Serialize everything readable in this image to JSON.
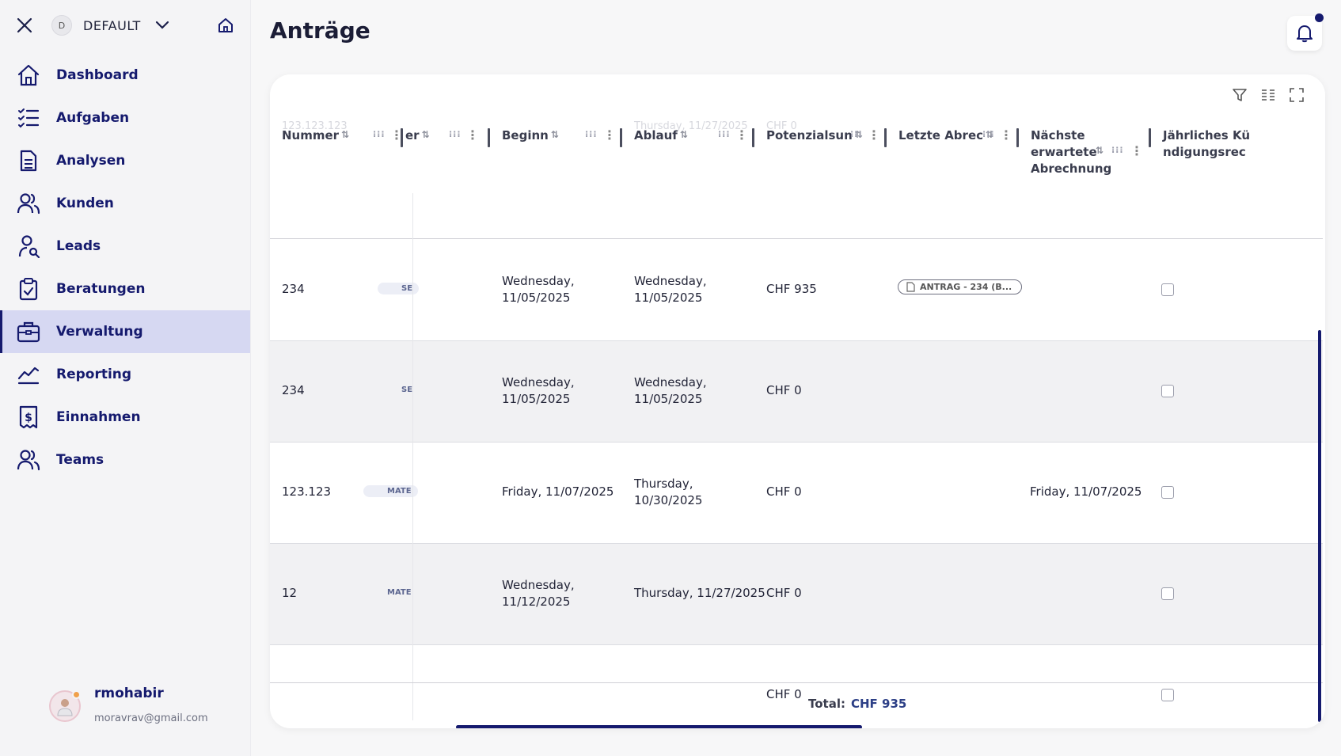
{
  "sidebar": {
    "org_badge": "D",
    "org_name": "DEFAULT",
    "nav": [
      {
        "label": "Dashboard",
        "icon": "home-icon"
      },
      {
        "label": "Aufgaben",
        "icon": "task-list-icon"
      },
      {
        "label": "Analysen",
        "icon": "document-icon"
      },
      {
        "label": "Kunden",
        "icon": "customers-icon"
      },
      {
        "label": "Leads",
        "icon": "leads-icon"
      },
      {
        "label": "Beratungen",
        "icon": "clipboard-icon"
      },
      {
        "label": "Verwaltung",
        "icon": "briefcase-icon",
        "active": true
      },
      {
        "label": "Reporting",
        "icon": "chart-line-icon"
      },
      {
        "label": "Einnahmen",
        "icon": "receipt-dollar-icon"
      },
      {
        "label": "Teams",
        "icon": "team-icon"
      }
    ],
    "user": {
      "name": "rmohabir",
      "email": "moravrav@gmail.com"
    }
  },
  "header": {
    "title": "Anträge"
  },
  "table": {
    "columns": {
      "nummer": "Nummer",
      "col2": "er",
      "beginn": "Beginn",
      "ablauf": "Ablauf",
      "potenzial": "Potenzialsun",
      "letzte": "Letzte Abrec",
      "naechste": "Nächste erwartete Abrechnung",
      "jaehrlich": "Jährliches Kündigungsrec"
    },
    "ghost_row": {
      "nummer": "123.123.123",
      "ablauf": "Thursday, 11/27/2025",
      "potenzial": "CHF 0"
    },
    "rows": [
      {
        "nummer": "234",
        "chip": "SE",
        "beginn": "Wednesday, 11/05/2025",
        "ablauf": "Wednesday, 11/05/2025",
        "potenzial": "CHF 935",
        "letzte": "ANTRAG - 234 (B...",
        "naechste": ""
      },
      {
        "nummer": "234",
        "chip": "SE",
        "beginn": "Wednesday, 11/05/2025",
        "ablauf": "Wednesday, 11/05/2025",
        "potenzial": "CHF 0",
        "letzte": "",
        "naechste": ""
      },
      {
        "nummer": "123.123",
        "chip": "MATE",
        "beginn": "Friday, 11/07/2025",
        "ablauf": "Thursday, 10/30/2025",
        "potenzial": "CHF 0",
        "letzte": "",
        "naechste": "Friday, 11/07/2025"
      },
      {
        "nummer": "12",
        "chip": "MATE",
        "beginn": "Wednesday, 11/12/2025",
        "ablauf": "Thursday, 11/27/2025",
        "potenzial": "CHF 0",
        "letzte": "",
        "naechste": ""
      },
      {
        "nummer": "",
        "chip": "",
        "beginn": "",
        "ablauf": "",
        "potenzial": "CHF 0",
        "letzte": "",
        "naechste": ""
      }
    ],
    "footer": {
      "total_label": "Total:",
      "total_value": "CHF 935"
    }
  }
}
